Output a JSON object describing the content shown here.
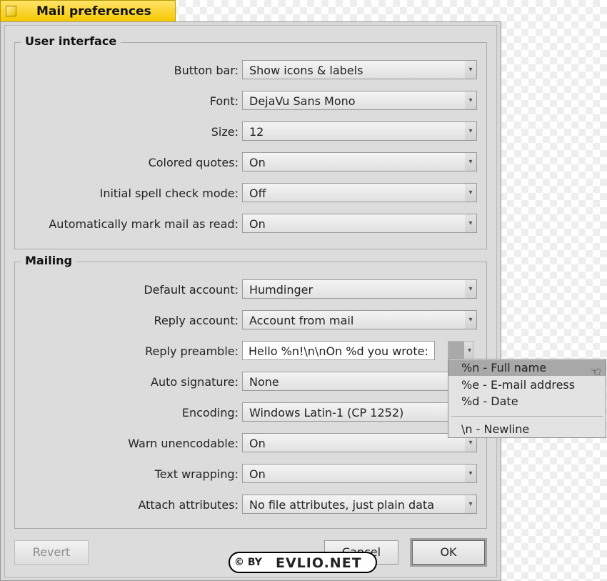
{
  "window": {
    "title": "Mail preferences"
  },
  "user_interface": {
    "heading": "User interface",
    "rows": [
      {
        "label": "Button bar:",
        "value": "Show icons & labels"
      },
      {
        "label": "Font:",
        "value": "DejaVu Sans Mono"
      },
      {
        "label": "Size:",
        "value": "12"
      },
      {
        "label": "Colored quotes:",
        "value": "On"
      },
      {
        "label": "Initial spell check mode:",
        "value": "Off"
      },
      {
        "label": "Automatically mark mail as read:",
        "value": "On"
      }
    ]
  },
  "mailing": {
    "heading": "Mailing",
    "rows": [
      {
        "label": "Default account:",
        "value": "Humdinger"
      },
      {
        "label": "Reply account:",
        "value": "Account from mail"
      },
      {
        "label": "Reply preamble:",
        "value": "Hello %n!\\n\\nOn %d you wrote:"
      },
      {
        "label": "Auto signature:",
        "value": "None"
      },
      {
        "label": "Encoding:",
        "value": "Windows Latin-1 (CP 1252)"
      },
      {
        "label": "Warn unencodable:",
        "value": "On"
      },
      {
        "label": "Text wrapping:",
        "value": "On"
      },
      {
        "label": "Attach attributes:",
        "value": "No file attributes, just plain data"
      }
    ]
  },
  "preamble_menu": {
    "items": [
      {
        "label": "%n - Full name",
        "selected": true
      },
      {
        "label": "%e - E-mail address",
        "selected": false
      },
      {
        "label": "%d - Date",
        "selected": false
      },
      {
        "label": "\\n - Newline",
        "selected": false
      }
    ]
  },
  "buttons": {
    "revert": "Revert",
    "cancel": "Cancel",
    "ok": "OK"
  },
  "watermark": {
    "by": "© BY",
    "site": "EVLIO.NET"
  }
}
